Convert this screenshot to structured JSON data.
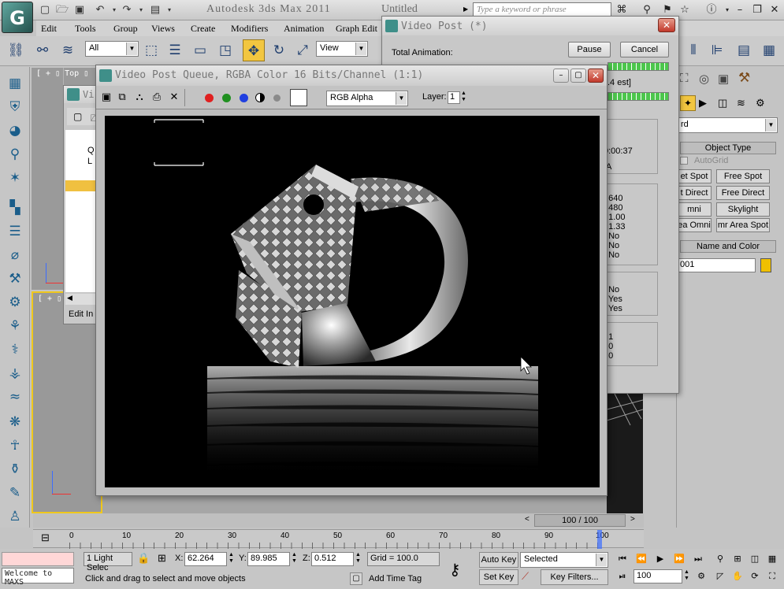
{
  "app": {
    "title": "Autodesk 3ds Max  2011",
    "file": "Untitled",
    "search_placeholder": "Type a keyword or phrase",
    "logo": "G"
  },
  "menu": [
    "Edit",
    "Tools",
    "Group",
    "Views",
    "Create",
    "Modifiers",
    "Animation",
    "Graph Edit"
  ],
  "toolbar": {
    "selection_filter": "All",
    "ref_coord": "View"
  },
  "viewports": {
    "top_label": "[ + ▯ Top ▯",
    "front_label": "[ + ▯",
    "persp_label": ""
  },
  "vpq_back": {
    "title": "Vi",
    "tree_q": "Q",
    "tree_l": "L",
    "edit_label": "Edit In"
  },
  "video_post": {
    "title": "Video Post (*)",
    "total_label": "Total Animation:",
    "pause": "Pause",
    "cancel": "Cancel",
    "est_label": ".4 est]",
    "time_line": "0:00:37",
    "na_line": "/A",
    "params_1": [
      ": 640",
      ": 480",
      ": 1.00",
      ": 1.33",
      ": No",
      ": No",
      ": No"
    ],
    "params_2": [
      ": No",
      ": Yes",
      ": Yes"
    ],
    "params_3": [
      ": 1",
      ": 0",
      ": 0"
    ]
  },
  "frame_window": {
    "title": "Video Post Queue, RGBA Color 16 Bits/Channel (1:1)",
    "channel": "RGB Alpha",
    "layer_label": "Layer:",
    "layer_value": "1"
  },
  "command_panel": {
    "category": "rd",
    "object_type_header": "Object Type",
    "autogrid": "AutoGrid",
    "buttons": [
      [
        "et Spot",
        "Free Spot"
      ],
      [
        "t Direct",
        "Free Direct"
      ],
      [
        "mni",
        "Skylight"
      ],
      [
        "ea Omni",
        "mr Area Spot"
      ]
    ],
    "name_color_header": "Name and Color",
    "name_value": "001",
    "swatch_color": "#f0c000"
  },
  "timeline": {
    "frame_counter": "100 / 100",
    "ticks": [
      "0",
      "10",
      "20",
      "30",
      "40",
      "50",
      "60",
      "70",
      "80",
      "90",
      "100"
    ],
    "slider_position": 1.0
  },
  "status": {
    "maxscript": "Welcome to MAXS",
    "selection": "1 Light Selec",
    "x_label": "X:",
    "x_value": "62.264",
    "y_label": "Y:",
    "y_value": "89.985",
    "z_label": "Z:",
    "z_value": "0.512",
    "grid": "Grid = 100.0",
    "prompt": "Click and drag to select and move objects",
    "add_time_tag": "Add Time Tag",
    "auto_key": "Auto Key",
    "set_key": "Set Key",
    "key_mode": "Selected",
    "key_filters": "Key Filters...",
    "frame": "100"
  }
}
